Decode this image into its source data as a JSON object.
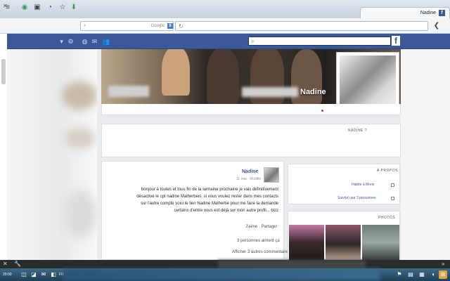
{
  "browser": {
    "tab_title": "Nadine",
    "new_tab_glyph": "+",
    "search_placeholder": "Google",
    "search_engine_badge": "8",
    "nav_icons": [
      "menu-icon",
      "comment-icon",
      "clipboard-icon",
      "download-icon",
      "star-icon",
      "lock-icon",
      "back-icon"
    ]
  },
  "profile": {
    "name": "Nadine",
    "about_strip": "NADINE ?"
  },
  "post": {
    "author": "Nadine",
    "meta": "11 mai · Modifié ·",
    "lines": [
      "bonjour à toutes et tous fin de la semaine prochaine je vais définitivement",
      "désactivé le cpt nadine Malherbeis. si vous voulez rester dans mes contacts",
      "sur l'autre compte voici le lien Nadine Malherbe pour me faire la demande",
      "certains d'entre vous est déjà sur mon autre profil... bizz"
    ],
    "actions": "J'aime · Partager",
    "likes": "3 personnes aiment ça",
    "comments": "Afficher 3 autres commentaires"
  },
  "sidebar": {
    "apropos_title": "À PROPOS",
    "apropos_line1": "Habite à Mons",
    "apropos_line2": "Suivi(e) par 3 personnes",
    "photos_title": "PHOTOS"
  },
  "taskbar": {
    "clock": "20:00",
    "language": "FR"
  },
  "colors": {
    "facebook_blue": "#3b5998",
    "link_blue": "#365899",
    "page_gray": "#e9ebee"
  }
}
